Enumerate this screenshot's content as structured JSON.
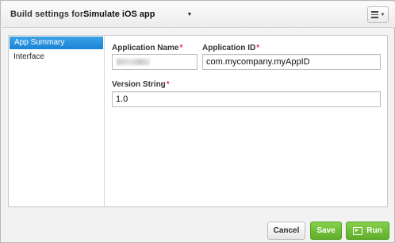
{
  "header": {
    "build_label": "Build settings for:",
    "config_value": "Simulate iOS app"
  },
  "sidebar": {
    "items": [
      {
        "label": "App Summary",
        "active": true
      },
      {
        "label": "Interface",
        "active": false
      }
    ]
  },
  "form": {
    "app_name_label": "Application Name",
    "app_name_value": "",
    "app_id_label": "Application ID",
    "app_id_value": "com.mycompany.myAppID",
    "version_label": "Version String",
    "version_value": "1.0",
    "required_marker": "*"
  },
  "footer": {
    "cancel_label": "Cancel",
    "save_label": "Save",
    "run_label": "Run"
  },
  "colors": {
    "accent": "#1a84d4",
    "primary_button": "#6cbc36",
    "required": "#d9364a"
  }
}
